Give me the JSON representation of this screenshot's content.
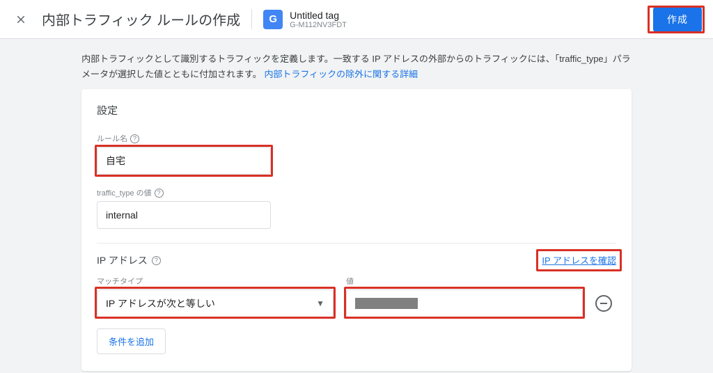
{
  "header": {
    "title": "内部トラフィック ルールの作成",
    "tag_name": "Untitled tag",
    "tag_id": "G-M112NV3FDT",
    "tag_icon_letter": "G",
    "create_label": "作成"
  },
  "description": {
    "text": "内部トラフィックとして識別するトラフィックを定義します。一致する IP アドレスの外部からのトラフィックには、「traffic_type」パラメータが選択した値とともに付加されます。",
    "link_text": "内部トラフィックの除外に関する詳細"
  },
  "settings": {
    "card_title": "設定",
    "rule_name_label": "ルール名",
    "rule_name_value": "自宅",
    "traffic_type_label": "traffic_type の値",
    "traffic_type_value": "internal"
  },
  "ip_section": {
    "title": "IP アドレス",
    "check_ip_link": "IP アドレスを確認",
    "match_type_label": "マッチタイプ",
    "match_type_value": "IP アドレスが次と等しい",
    "value_label": "値",
    "add_condition_label": "条件を追加",
    "help_symbol": "?"
  }
}
